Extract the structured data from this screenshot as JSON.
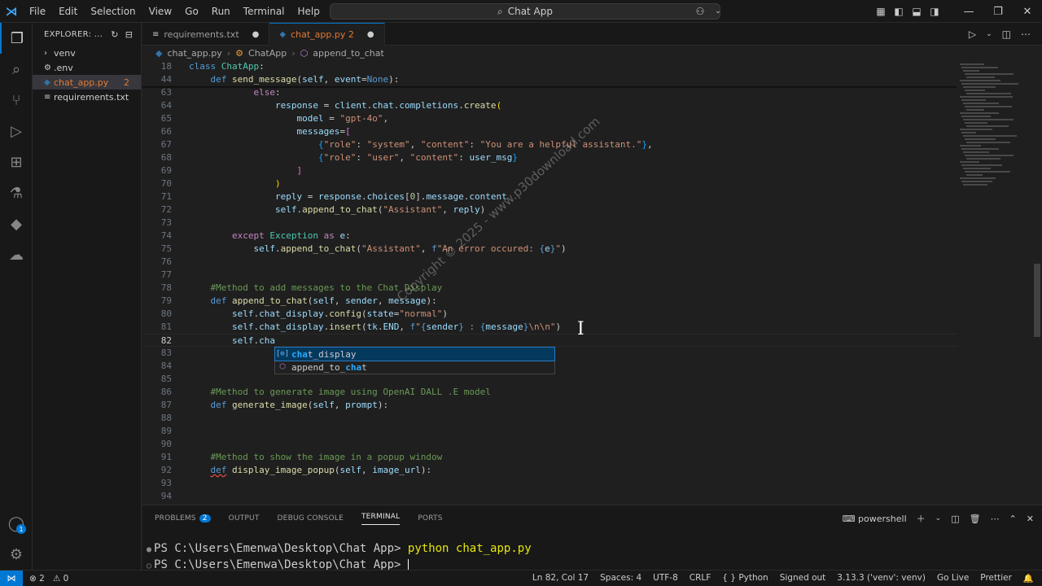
{
  "titlebar": {
    "menu": [
      "File",
      "Edit",
      "Selection",
      "View",
      "Go",
      "Run",
      "Terminal",
      "Help"
    ],
    "search_text": "Chat App",
    "nav_back": "←",
    "nav_fwd": "→"
  },
  "sidebar": {
    "title": "EXPLORER: ...",
    "items": [
      {
        "label": "venv",
        "kind": "folder"
      },
      {
        "label": ".env",
        "kind": "file"
      },
      {
        "label": "chat_app.py",
        "kind": "file",
        "count": "2"
      },
      {
        "label": "requirements.txt",
        "kind": "file"
      }
    ]
  },
  "tabs": [
    {
      "label": "requirements.txt",
      "marker": "●"
    },
    {
      "label": "chat_app.py 2",
      "marker": "●"
    }
  ],
  "breadcrumb": {
    "file": "chat_app.py",
    "cls": "ChatApp",
    "method": "append_to_chat"
  },
  "editor": {
    "lines": [
      {
        "n": "18",
        "html": "<span class=\"kw\">class</span> <span class=\"cls\">ChatApp</span>:"
      },
      {
        "n": "44",
        "html": "    <span class=\"kw\">def</span> <span class=\"fn\">send_message</span>(<span class=\"var\">self</span>, <span class=\"var\">event</span>=<span class=\"kw\">None</span>):"
      },
      {
        "n": "63",
        "html": "            <span class=\"kw2\">else</span>:"
      },
      {
        "n": "64",
        "html": "                <span class=\"var\">response</span> = <span class=\"var\">client</span>.<span class=\"var\">chat</span>.<span class=\"var\">completions</span>.<span class=\"fn\">create</span><span class=\"br1\">(</span>"
      },
      {
        "n": "65",
        "html": "                    <span class=\"var\">model</span> = <span class=\"str\">\"gpt-4o\"</span>,"
      },
      {
        "n": "66",
        "html": "                    <span class=\"var\">messages</span>=<span class=\"br2\">[</span>"
      },
      {
        "n": "67",
        "html": "                        <span class=\"br3\">{</span><span class=\"str\">\"role\"</span>: <span class=\"str\">\"system\"</span>, <span class=\"str\">\"content\"</span>: <span class=\"str\">\"You are a helpful assistant.\"</span><span class=\"br3\">}</span>,"
      },
      {
        "n": "68",
        "html": "                        <span class=\"br3\">{</span><span class=\"str\">\"role\"</span>: <span class=\"str\">\"user\"</span>, <span class=\"str\">\"content\"</span>: <span class=\"var\">user_msg</span><span class=\"br3\">}</span>"
      },
      {
        "n": "69",
        "html": "                    <span class=\"br2\">]</span>"
      },
      {
        "n": "70",
        "html": "                <span class=\"br1\">)</span>"
      },
      {
        "n": "71",
        "html": "                <span class=\"var\">reply</span> = <span class=\"var\">response</span>.<span class=\"var\">choices</span>[<span class=\"num\">0</span>].<span class=\"var\">message</span>.<span class=\"var\">content</span>"
      },
      {
        "n": "72",
        "html": "                <span class=\"var\">self</span>.<span class=\"fn\">append_to_chat</span>(<span class=\"str\">\"Assistant\"</span>, <span class=\"var\">reply</span>)"
      },
      {
        "n": "73",
        "html": ""
      },
      {
        "n": "74",
        "html": "        <span class=\"kw2\">except</span> <span class=\"cls\">Exception</span> <span class=\"kw2\">as</span> <span class=\"var\">e</span>:"
      },
      {
        "n": "75",
        "html": "            <span class=\"var\">self</span>.<span class=\"fn\">append_to_chat</span>(<span class=\"str\">\"Assistant\"</span>, <span class=\"kw\">f</span><span class=\"str\">\"An error occured: </span><span class=\"kw\">{</span><span class=\"var\">e</span><span class=\"kw\">}</span><span class=\"str\">\"</span>)"
      },
      {
        "n": "76",
        "html": ""
      },
      {
        "n": "77",
        "html": ""
      },
      {
        "n": "78",
        "html": "    <span class=\"cm\">#Method to add messages to the Chat Display</span>"
      },
      {
        "n": "79",
        "html": "    <span class=\"kw\">def</span> <span class=\"fn\">append_to_chat</span>(<span class=\"var\">self</span>, <span class=\"var\">sender</span>, <span class=\"var\">message</span>):"
      },
      {
        "n": "80",
        "html": "        <span class=\"var\">self</span>.<span class=\"var\">chat_display</span>.<span class=\"fn\">config</span>(<span class=\"var\">state</span>=<span class=\"str\">\"normal\"</span>)"
      },
      {
        "n": "81",
        "html": "        <span class=\"var\">self</span>.<span class=\"var\">chat_display</span>.<span class=\"fn\">insert</span>(<span class=\"var\">tk</span>.<span class=\"var\">END</span>, <span class=\"kw\">f</span><span class=\"str\">\"</span><span class=\"kw\">{</span><span class=\"var\">sender</span><span class=\"kw\">}</span><span class=\"str\"> : </span><span class=\"kw\">{</span><span class=\"var\">message</span><span class=\"kw\">}</span><span class=\"str\">\\n\\n\"</span>)"
      },
      {
        "n": "82",
        "html": "        <span class=\"var\">self</span>.<span class=\"var\">cha</span>"
      },
      {
        "n": "83",
        "html": ""
      },
      {
        "n": "84",
        "html": ""
      },
      {
        "n": "85",
        "html": ""
      },
      {
        "n": "86",
        "html": "    <span class=\"cm\">#Method to generate image using OpenAI DALL .E model</span>"
      },
      {
        "n": "87",
        "html": "    <span class=\"kw\">def</span> <span class=\"fn\">generate_image</span>(<span class=\"var\">self</span>, <span class=\"var\">prompt</span>):"
      },
      {
        "n": "88",
        "html": ""
      },
      {
        "n": "89",
        "html": ""
      },
      {
        "n": "90",
        "html": ""
      },
      {
        "n": "91",
        "html": "    <span class=\"cm\">#Method to show the image in a popup window</span>"
      },
      {
        "n": "92",
        "html": "    <span class=\"kw\" style=\"text-decoration: underline wavy #f14c4c;\">def</span> <span class=\"fn\">display_image_popup</span>(<span class=\"var\">self</span>, <span class=\"var\">image_url</span>):"
      },
      {
        "n": "93",
        "html": ""
      },
      {
        "n": "94",
        "html": ""
      }
    ],
    "current_line": "82"
  },
  "suggest": [
    {
      "prefix": "cha",
      "rest": "t_display",
      "selected": true
    },
    {
      "prefix": "append_to_",
      "highlight": "cha",
      "rest": "t",
      "selected": false
    }
  ],
  "watermark": "Copyright © 2025 - www.p30download.com",
  "panel": {
    "tabs": [
      "PROBLEMS",
      "OUTPUT",
      "DEBUG CONSOLE",
      "TERMINAL",
      "PORTS"
    ],
    "problems_count": "2",
    "shell": "powershell",
    "terminal_lines": [
      {
        "prompt": "PS C:\\Users\\Emenwa\\Desktop\\Chat App> ",
        "cmd": "python chat_app.py"
      },
      {
        "prompt": "PS C:\\Users\\Emenwa\\Desktop\\Chat App> ",
        "cmd": ""
      }
    ]
  },
  "status": {
    "errors": "⊗ 2",
    "warnings": "⚠ 0",
    "right": [
      "Ln 82, Col 17",
      "Spaces: 4",
      "UTF-8",
      "CRLF",
      "{ } Python",
      "Signed out",
      "3.13.3 ('venv': venv)",
      "Go Live",
      "Prettier"
    ]
  }
}
